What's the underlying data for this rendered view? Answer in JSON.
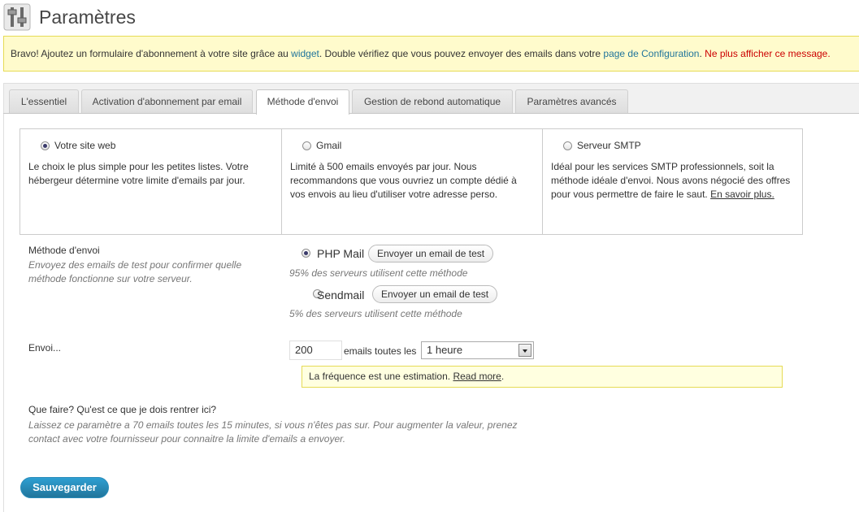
{
  "page": {
    "title": "Paramètres",
    "icon": "settings-sliders-icon"
  },
  "notice": {
    "text_before": "Bravo! Ajoutez un formulaire d'abonnement à votre site grâce au ",
    "widget_link": "widget",
    "text_middle": ". Double vérifiez que vous pouvez envoyer des emails dans votre ",
    "config_link": "page de Configuration",
    "text_after": ". ",
    "dismiss_link": "Ne plus afficher ce message."
  },
  "tabs": [
    {
      "label": "L'essentiel",
      "active": false
    },
    {
      "label": "Activation d'abonnement par email",
      "active": false
    },
    {
      "label": "Méthode d'envoi",
      "active": true
    },
    {
      "label": "Gestion de rebond automatique",
      "active": false
    },
    {
      "label": "Paramètres avancés",
      "active": false
    }
  ],
  "methods": [
    {
      "title": "Votre site web",
      "checked": true,
      "description": "Le choix le plus simple pour les petites listes. Votre hébergeur détermine votre limite d'emails par jour.",
      "link": ""
    },
    {
      "title": "Gmail",
      "checked": false,
      "description": "Limité à 500 emails envoyés par jour. Nous recommandons que vous ouvriez un compte dédié à vos envois au lieu d'utiliser votre adresse perso.",
      "link": ""
    },
    {
      "title": "Serveur SMTP",
      "checked": false,
      "description": "Idéal pour les services SMTP professionnels, soit la méthode idéale d'envoi. Nous avons négocié des offres pour vous permettre de faire le saut. ",
      "link": "En savoir plus."
    }
  ],
  "send_method": {
    "label": "Méthode d'envoi",
    "help": "Envoyez des emails de test pour confirmer quelle méthode fonctionne sur votre serveur.",
    "options": [
      {
        "name": "PHP Mail",
        "checked": true,
        "button": "Envoyer un email de test",
        "note": "95% des serveurs utilisent cette méthode"
      },
      {
        "name": "Sendmail",
        "checked": false,
        "button": "Envoyer un email de test",
        "note": "5% des serveurs utilisent cette méthode"
      }
    ]
  },
  "sending": {
    "label": "Envoi...",
    "emails_value": "200",
    "emails_suffix": "emails toutes les",
    "frequency_selected": "1 heure",
    "note_text": "La fréquence est une estimation. ",
    "note_link": "Read more",
    "note_end": "."
  },
  "faq": {
    "question": "Que faire? Qu'est ce que je dois rentrer ici?",
    "answer": "Laissez ce paramètre a 70 emails toutes les 15 minutes, si vous n'êtes pas sur. Pour augmenter la valeur, prenez contact avec votre fournisseur pour connaitre la limite d'emails a envoyer."
  },
  "save_label": "Sauvegarder"
}
